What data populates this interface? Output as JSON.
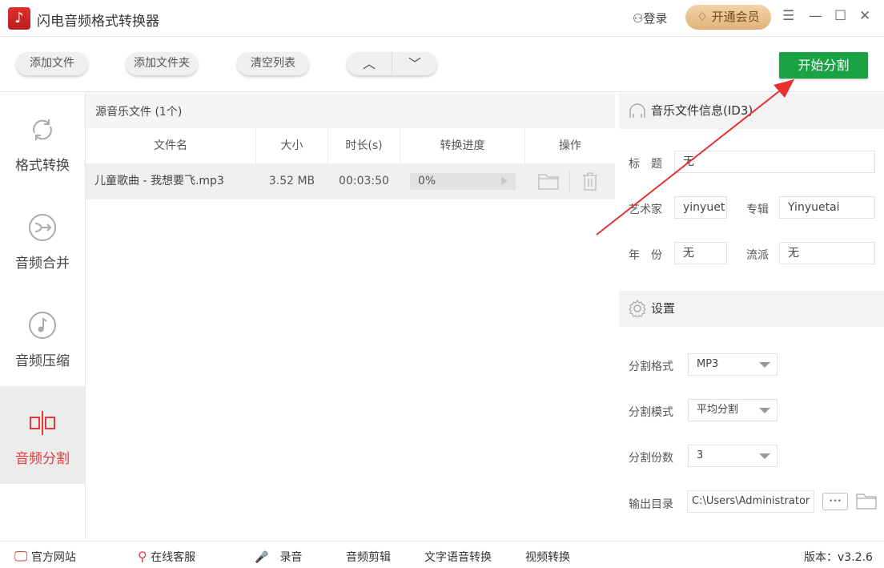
{
  "app": {
    "title": "闪电音频格式转换器",
    "login": "登录",
    "vip": "开通会员"
  },
  "toolbar": {
    "add_file": "添加文件",
    "add_folder": "添加文件夹",
    "clear_list": "清空列表",
    "start": "开始分割"
  },
  "sidebar": {
    "items": [
      {
        "label": "格式转换"
      },
      {
        "label": "音频合并"
      },
      {
        "label": "音频压缩"
      },
      {
        "label": "音频分割",
        "active": true
      }
    ]
  },
  "list": {
    "title": "源音乐文件 (1个)",
    "columns": [
      "文件名",
      "大小",
      "时长(s)",
      "转换进度",
      "操作"
    ],
    "rows": [
      {
        "name": "儿童歌曲 - 我想要飞.mp3",
        "size": "3.52 MB",
        "duration": "00:03:50",
        "progress": "0%"
      }
    ]
  },
  "id3": {
    "title": "音乐文件信息(ID3)",
    "fields": {
      "title_label": "标　题",
      "title_value": "无",
      "artist_label": "艺术家",
      "artist_value": "yinyuet",
      "album_label": "专辑",
      "album_value": "Yinyuetai",
      "year_label": "年　份",
      "year_value": "无",
      "genre_label": "流派",
      "genre_value": "无"
    }
  },
  "settings": {
    "title": "设置",
    "format_label": "分割格式",
    "format_value": "MP3",
    "mode_label": "分割模式",
    "mode_value": "平均分割",
    "count_label": "分割份数",
    "count_value": "3",
    "output_label": "输出目录",
    "output_value": "C:\\Users\\Administrator",
    "browse": "•••"
  },
  "footer": {
    "website": "官方网站",
    "support": "在线客服",
    "record": "录音",
    "audio_edit": "音频剪辑",
    "tts": "文字语音转换",
    "video": "视频转换",
    "version": "版本：v3.2.6"
  },
  "colors": {
    "accent_red": "#e23b3b",
    "start_green": "#1aa344",
    "annotation": "#e8302f"
  }
}
